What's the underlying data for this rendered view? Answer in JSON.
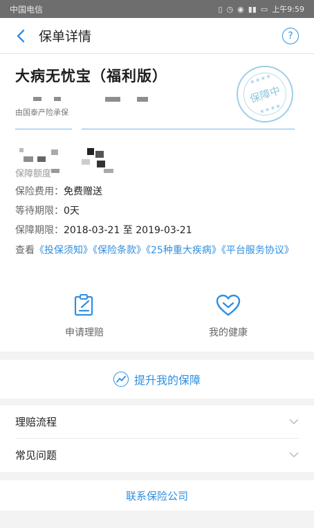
{
  "status_bar": {
    "carrier": "中国电信",
    "time": "上午9:59"
  },
  "nav": {
    "title": "保单详情",
    "help_icon": "?"
  },
  "policy": {
    "product_name": "大病无忧宝（福利版）",
    "insurer": "由国泰产险承保",
    "stamp_text": "保障中",
    "amount_label": "保障额度"
  },
  "info": [
    {
      "label": "保险费用：",
      "value": "免费赠送"
    },
    {
      "label": "等待期限：",
      "value": "0天"
    },
    {
      "label": "保障期限：",
      "value": "2018-03-21 至 2019-03-21"
    }
  ],
  "terms": {
    "prefix": "查看",
    "links": [
      "《投保须知》",
      "《保险条款》",
      "《25种重大疾病》",
      "《平台服务协议》"
    ]
  },
  "actions": {
    "claim": "申请理赔",
    "health": "我的健康"
  },
  "upgrade": "提升我的保障",
  "faq": {
    "claim_process": "理赔流程",
    "common_questions": "常见问题"
  },
  "contact": "联系保险公司",
  "colors": {
    "accent": "#2f8fe3",
    "stamp": "#8cc8e1"
  }
}
